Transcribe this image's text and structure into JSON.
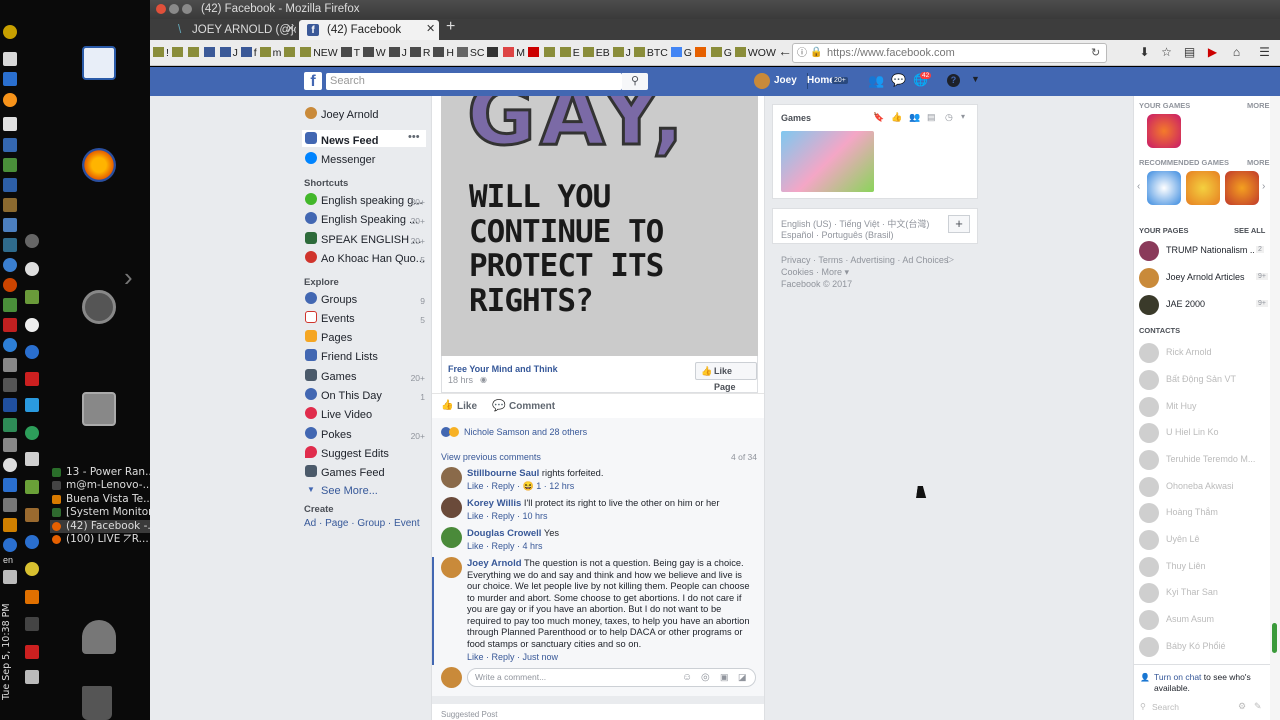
{
  "os": {
    "clock": "Tue Sep 5, 10:38 PM",
    "lang": "en",
    "tasks": [
      {
        "label": "13 - Power Ran...",
        "color": "#2a6e2a"
      },
      {
        "label": "m@m-Lenovo-...",
        "color": "#444"
      },
      {
        "label": "Buena Vista Te...",
        "color": "#d87a00"
      },
      {
        "label": "[System Monitor]",
        "color": "#2f6a2f"
      },
      {
        "label": "(42) Facebook -...",
        "color": "#e66000"
      },
      {
        "label": "(100) LIVE ⦢R...",
        "color": "#e66000"
      }
    ]
  },
  "browser": {
    "window_title": "(42) Facebook - Mozilla Firefox",
    "tabs": [
      {
        "label": "JOEY ARNOLD (@joey"
      },
      {
        "label": "(42) Facebook"
      }
    ],
    "new_tab": "+",
    "url": "https://www.facebook.com",
    "bookmarks": [
      "!",
      "",
      "",
      "J",
      "f",
      "",
      "m",
      "",
      "NEW",
      "T",
      "W",
      "J",
      "R",
      "H",
      "SC",
      "",
      "M",
      "",
      "",
      "E",
      "EB",
      "J",
      "BTC",
      "G",
      "",
      "G",
      "WOW"
    ]
  },
  "fb": {
    "search_placeholder": "Search",
    "user": "Joey",
    "home": "Home",
    "home_count": "20+",
    "notif_count": "42",
    "left": {
      "profile": "Joey Arnold",
      "news_feed": "News Feed",
      "messenger": "Messenger",
      "shortcuts_title": "Shortcuts",
      "shortcuts": [
        {
          "label": "English speaking g...",
          "count": "20+"
        },
        {
          "label": "English Speaking ...",
          "count": "20+"
        },
        {
          "label": "SPEAK ENGLISH ...",
          "count": "20+"
        },
        {
          "label": "Ao Khoac Han Quo...",
          "count": "5"
        }
      ],
      "explore_title": "Explore",
      "explore": [
        {
          "label": "Groups",
          "count": "9"
        },
        {
          "label": "Events",
          "count": "5"
        },
        {
          "label": "Pages",
          "count": ""
        },
        {
          "label": "Friend Lists",
          "count": ""
        },
        {
          "label": "Games",
          "count": "20+"
        },
        {
          "label": "On This Day",
          "count": "1"
        },
        {
          "label": "Live Video",
          "count": ""
        },
        {
          "label": "Pokes",
          "count": "20+"
        },
        {
          "label": "Suggest Edits",
          "count": ""
        },
        {
          "label": "Games Feed",
          "count": ""
        }
      ],
      "see_more": "See More...",
      "create_title": "Create",
      "create_links": "Ad · Page · Group · Event"
    },
    "post": {
      "image_word": "GAY,",
      "image_question": "WILL YOU\nCONTINUE TO\nPROTECT ITS\nRIGHTS?",
      "page_name": "Free Your Mind and Think",
      "time": "18 hrs",
      "like_page": "Like Page",
      "like": "Like",
      "comment": "Comment",
      "reactions": "Nichole Samson and 28 others",
      "view_previous": "View previous comments",
      "count": "4 of 34",
      "comments": [
        {
          "name": "Stillbourne Saul",
          "text": "rights forfeited.",
          "actions": "Like · Reply · 😆 1 · 12 hrs"
        },
        {
          "name": "Korey Willis",
          "text": "I'll protect its right to live the other on him or her",
          "actions": "Like · Reply · 10 hrs"
        },
        {
          "name": "Douglas Crowell",
          "text": "Yes",
          "actions": "Like · Reply · 4 hrs"
        },
        {
          "name": "Joey Arnold",
          "text": "The question is not a question. Being gay is a choice. Everything we do and say and think and how we believe and live is our choice. We let people live by not killing them. People can choose to murder and abort. Some choose to get abortions. I do not care if you are gay or if you have an abortion. But I do not want to be required to pay too much money, taxes, to help you have an abortion through Planned Parenthood or to help DACA or other programs or food stamps or sanctuary cities and so on.",
          "actions": "Like · Reply · Just now"
        }
      ],
      "write_placeholder": "Write a comment...",
      "suggested": "Suggested Post"
    },
    "right": {
      "games_title": "Games",
      "languages": "English (US) · Tiếng Việt · 中文(台灣)",
      "languages2": "Español · Português (Brasil)",
      "add": "+",
      "footer1": "Privacy · Terms · Advertising · Ad Choices",
      "footer2": "Cookies · More ▾",
      "footer3": "Facebook © 2017"
    },
    "chat": {
      "your_games": "YOUR GAMES",
      "more1": "MORE",
      "recommended": "RECOMMENDED GAMES",
      "more2": "MORE",
      "your_pages": "YOUR PAGES",
      "see_all": "SEE ALL",
      "pages": [
        {
          "label": "TRUMP Nationalism ...",
          "count": "2"
        },
        {
          "label": "Joey Arnold Articles",
          "count": "9+"
        },
        {
          "label": "JAE 2000",
          "count": "9+"
        }
      ],
      "contacts_title": "CONTACTS",
      "contacts": [
        "Rick Arnold",
        "Bất Động Sản VT",
        "Mit Huy",
        "U Hiel Lin Ko",
        "Teruhide Teremdo M...",
        "Ohoneba Akwasi",
        "Hoàng Thắm",
        "Uyên Lê",
        "Thuy Liên",
        "Kyi Thar San",
        "Asum Asum",
        "Báby Kó Phổié"
      ],
      "turn_on_chat": "Turn on chat",
      "turn_on_rest": " to see who's available.",
      "search": "Search"
    }
  },
  "colors": {
    "fb_blue": "#4267b2",
    "link": "#385898",
    "page_bg": "#e9ebee"
  }
}
